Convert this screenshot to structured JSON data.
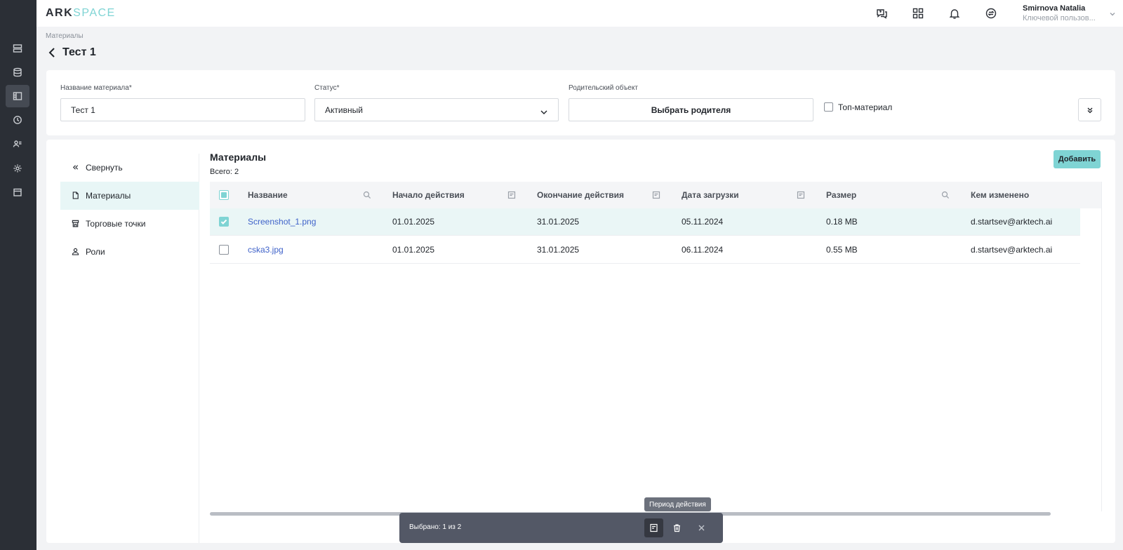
{
  "app": {
    "logo_ark": "ARK",
    "logo_space": "SPACE"
  },
  "rail": {
    "icons": [
      "server-icon",
      "database-icon",
      "layout-icon",
      "clock-icon",
      "users-icon",
      "gear-icon",
      "calendar-icon"
    ],
    "active_index": 2
  },
  "topbar": {
    "icons": [
      "help-chat-icon",
      "apps-grid-icon",
      "bell-icon",
      "sync-icon"
    ],
    "user_name": "Smirnova Natalia",
    "user_role": "Ключевой пользов..."
  },
  "breadcrumb": "Материалы",
  "page_title": "Тест 1",
  "form": {
    "name_label": "Название материала*",
    "name_value": "Тест 1",
    "status_label": "Статус*",
    "status_value": "Активный",
    "parent_label": "Родительский объект",
    "parent_button": "Выбрать родителя",
    "top_material_label": "Топ-материал",
    "top_material_checked": false
  },
  "sidebar": {
    "collapse_label": "Свернуть",
    "items": [
      {
        "label": "Материалы",
        "icon": "file-icon",
        "active": true
      },
      {
        "label": "Торговые точки",
        "icon": "store-icon",
        "active": false
      },
      {
        "label": "Роли",
        "icon": "user-icon",
        "active": false
      }
    ]
  },
  "content": {
    "title": "Материалы",
    "count": "Всего: 2",
    "add_button": "Добавить"
  },
  "table": {
    "columns": [
      "Название",
      "Начало действия",
      "Окончание действия",
      "Дата загрузки",
      "Размер",
      "Кем изменено"
    ],
    "rows": [
      {
        "name": "Screenshot_1.png",
        "start": "01.01.2025",
        "end": "31.01.2025",
        "uploaded": "05.11.2024",
        "size": "0.18 MB",
        "modified_by": "d.startsev@arktech.ai",
        "checked": true
      },
      {
        "name": "cska3.jpg",
        "start": "01.01.2025",
        "end": "31.01.2025",
        "uploaded": "06.11.2024",
        "size": "0.55 MB",
        "modified_by": "d.startsev@arktech.ai",
        "checked": false
      }
    ]
  },
  "selection_bar": {
    "text": "Выбрано: 1 из 2",
    "tooltip": "Период действия"
  },
  "colors": {
    "accent": "#7fd4d4",
    "rail": "#2b2f36",
    "link": "#3f62c9"
  }
}
